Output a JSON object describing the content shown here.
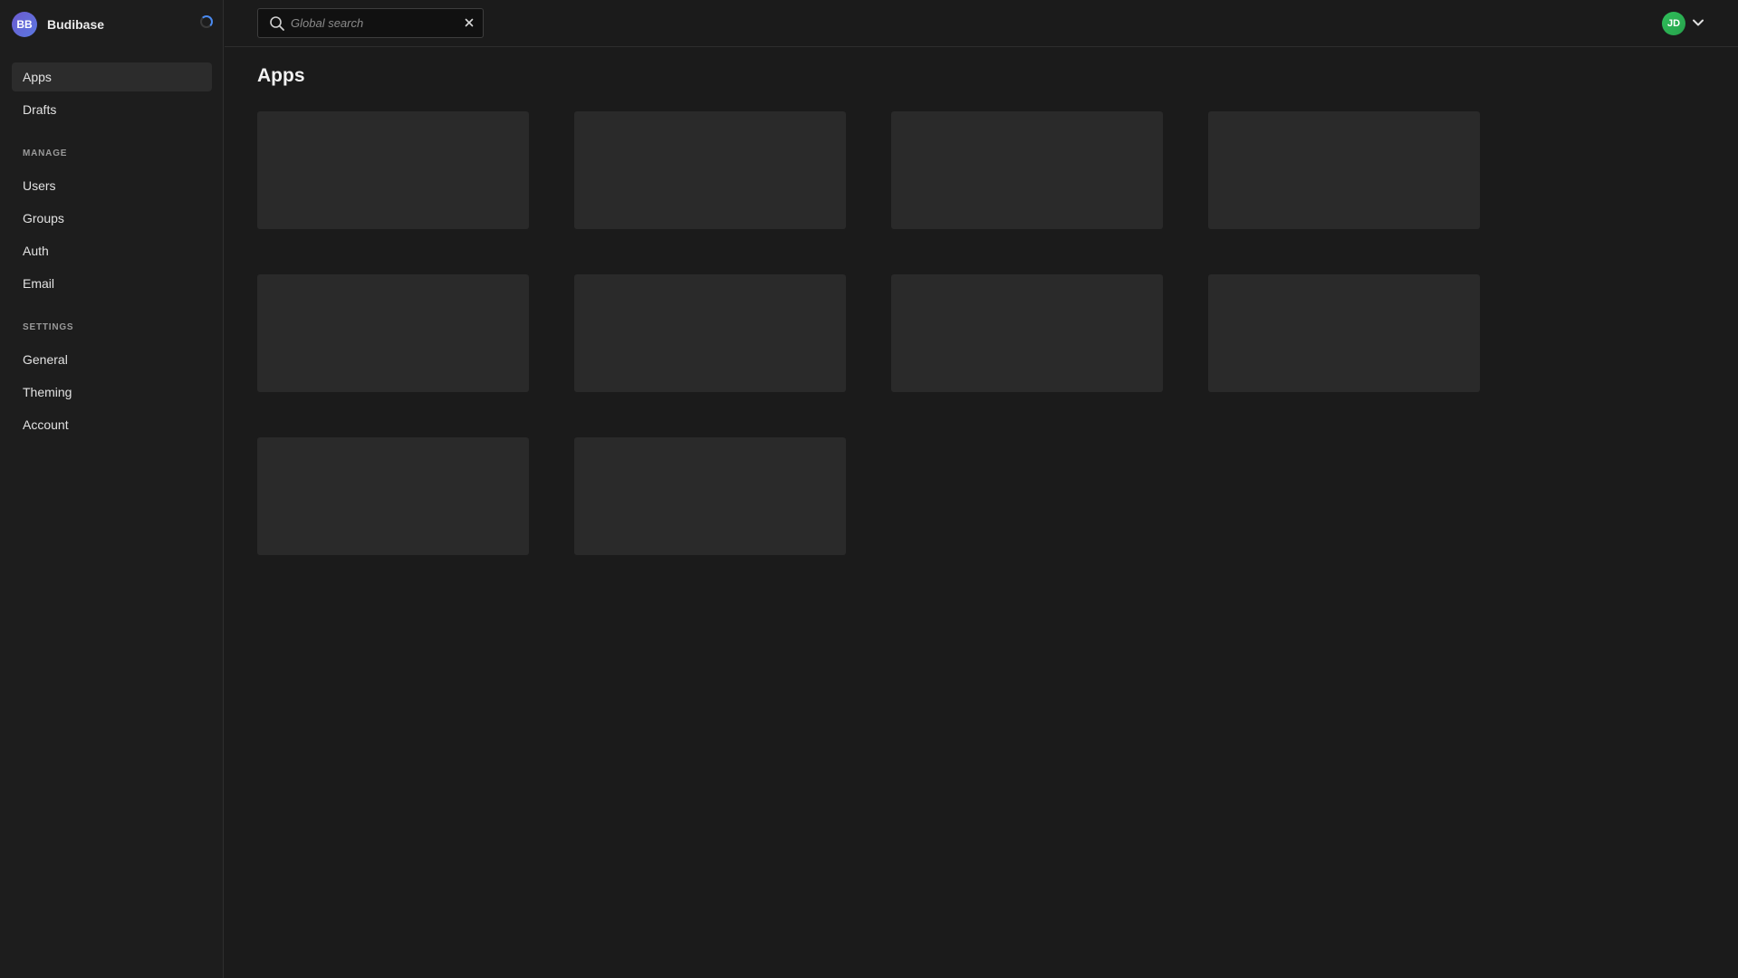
{
  "brand": {
    "initials": "BB",
    "name": "Budibase"
  },
  "sidebar": {
    "items": [
      {
        "label": "Apps"
      },
      {
        "label": "Drafts"
      }
    ],
    "manage": {
      "heading": "MANAGE",
      "items": [
        {
          "label": "Users"
        },
        {
          "label": "Groups"
        },
        {
          "label": "Auth"
        },
        {
          "label": "Email"
        }
      ]
    },
    "settings": {
      "heading": "SETTINGS",
      "items": [
        {
          "label": "General"
        },
        {
          "label": "Theming"
        },
        {
          "label": "Account"
        }
      ]
    },
    "active_item": "Apps"
  },
  "search": {
    "placeholder": "Global search",
    "value": ""
  },
  "user": {
    "initials": "JD"
  },
  "main": {
    "title": "Apps",
    "loading_card_count": 10
  },
  "icons": {
    "search": "search-icon",
    "clear": "close-icon",
    "chevron": "chevron-down-icon",
    "spinner": "loading-spinner-icon"
  },
  "colors": {
    "background": "#1b1b1b",
    "sidebar": "#1d1d1d",
    "card": "#2a2a2a",
    "accent_spinner": "#4a8af0",
    "brand_avatar": "#6d5bd0",
    "user_avatar": "#2fbf5a"
  }
}
